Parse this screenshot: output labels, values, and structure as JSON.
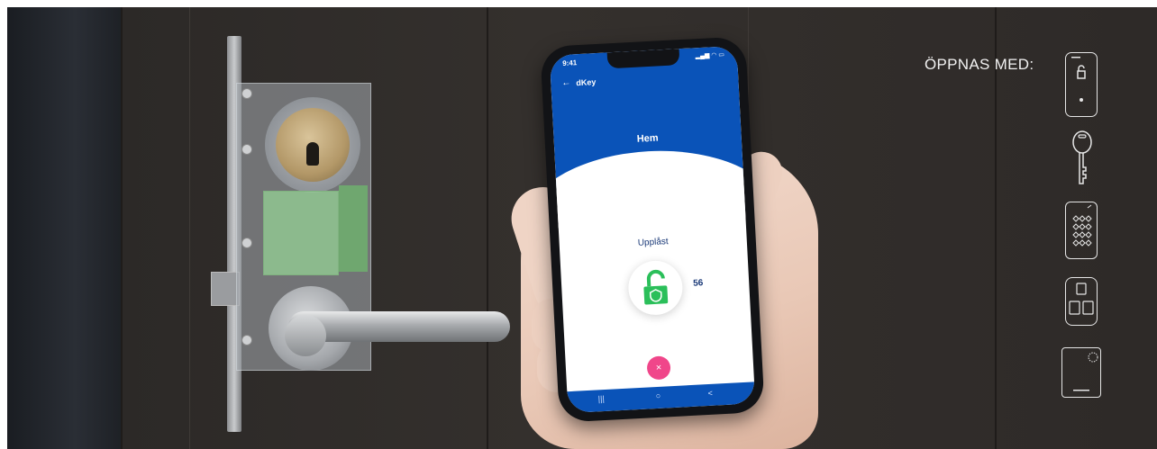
{
  "phone": {
    "time": "9:41",
    "app_name": "dKey",
    "home_title": "Hem",
    "lock_state": "Upplåst",
    "count": "56",
    "close_symbol": "×",
    "nav": [
      "|||",
      "○",
      "<"
    ]
  },
  "panel": {
    "opens_with_label": "ÖPPNAS MED:",
    "options": [
      "phone-icon",
      "key-icon",
      "keypad-icon",
      "remote-icon",
      "card-reader-icon"
    ]
  },
  "colors": {
    "app_blue": "#0a53b8",
    "unlock_green": "#2bbf5a",
    "close_pink": "#f0468a",
    "door": "#302c29"
  }
}
